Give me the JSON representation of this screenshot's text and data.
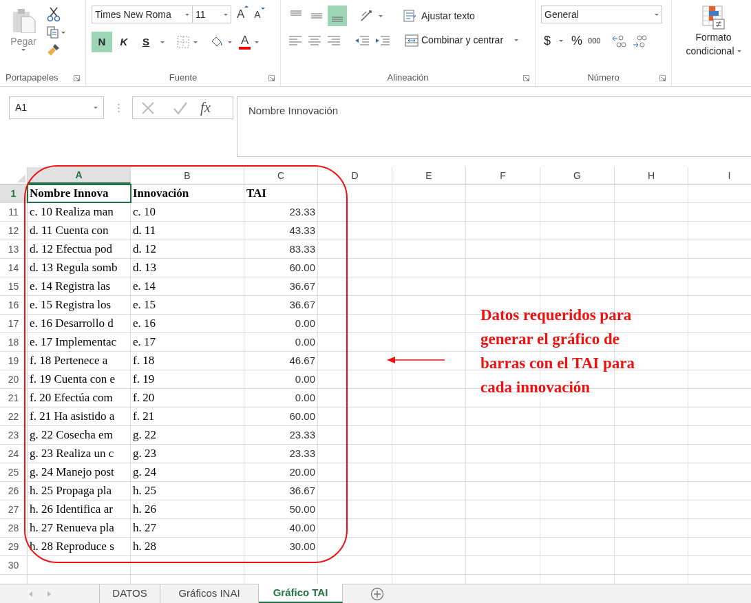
{
  "ribbon": {
    "clipboard": {
      "paste_label": "Pegar",
      "group_label": "Portapapeles"
    },
    "font": {
      "name": "Times New Roma",
      "size": "11",
      "grow_label": "A",
      "shrink_label": "A",
      "color_label": "A",
      "group_label": "Fuente",
      "style_buttons": [
        {
          "label": "N",
          "selected": true
        },
        {
          "label": "K",
          "selected": false
        },
        {
          "label": "S",
          "selected": false
        }
      ]
    },
    "alignment": {
      "group_label": "Alineación",
      "wrap_label": "Ajustar texto",
      "merge_label": "Combinar y centrar",
      "vertical_align": [
        {
          "kind": "top",
          "selected": false
        },
        {
          "kind": "middle",
          "selected": false
        },
        {
          "kind": "bottom",
          "selected": true
        }
      ]
    },
    "number": {
      "format": "General",
      "group_label": "Número",
      "symbols": [
        "$",
        "%",
        "000"
      ]
    },
    "styles": {
      "conditional_format_lines": [
        "Formato",
        "condicional"
      ]
    }
  },
  "formula_bar": {
    "name_box": "A1",
    "fx_label": "fx",
    "content": "Nombre Innovación"
  },
  "sheet": {
    "columns": [
      {
        "label": "A",
        "selected": true
      },
      {
        "label": "B",
        "selected": false
      },
      {
        "label": "C",
        "selected": false
      },
      {
        "label": "D",
        "selected": false
      },
      {
        "label": "E",
        "selected": false
      },
      {
        "label": "F",
        "selected": false
      },
      {
        "label": "G",
        "selected": false
      },
      {
        "label": "H",
        "selected": false
      },
      {
        "label": "I",
        "selected": false
      }
    ],
    "rows": [
      {
        "number": "1",
        "selected": true,
        "kind": "header",
        "cells": [
          "Nombre Innova",
          "Innovación",
          "TAI"
        ]
      },
      {
        "number": "11",
        "selected": false,
        "kind": "data",
        "cells": [
          "c. 10 Realiza man",
          "c. 10",
          "23.33"
        ]
      },
      {
        "number": "12",
        "selected": false,
        "kind": "data",
        "cells": [
          "d. 11 Cuenta con",
          "d. 11",
          "43.33"
        ]
      },
      {
        "number": "13",
        "selected": false,
        "kind": "data",
        "cells": [
          "d. 12 Efectua pod",
          "d. 12",
          "83.33"
        ]
      },
      {
        "number": "14",
        "selected": false,
        "kind": "data",
        "cells": [
          "d. 13 Regula somb",
          "d. 13",
          "60.00"
        ]
      },
      {
        "number": "15",
        "selected": false,
        "kind": "data",
        "cells": [
          "e. 14 Registra las",
          "e. 14",
          "36.67"
        ]
      },
      {
        "number": "16",
        "selected": false,
        "kind": "data",
        "cells": [
          "e. 15 Registra los",
          "e. 15",
          "36.67"
        ]
      },
      {
        "number": "17",
        "selected": false,
        "kind": "data",
        "cells": [
          "e. 16 Desarrollo d",
          "e. 16",
          "0.00"
        ]
      },
      {
        "number": "18",
        "selected": false,
        "kind": "data",
        "cells": [
          "e. 17 Implementac",
          "e. 17",
          "0.00"
        ]
      },
      {
        "number": "19",
        "selected": false,
        "kind": "data",
        "cells": [
          "f. 18 Pertenece a",
          "f. 18",
          "46.67"
        ]
      },
      {
        "number": "20",
        "selected": false,
        "kind": "data",
        "cells": [
          "f. 19 Cuenta con e",
          "f. 19",
          "0.00"
        ]
      },
      {
        "number": "21",
        "selected": false,
        "kind": "data",
        "cells": [
          "f. 20 Efectúa com",
          "f. 20",
          "0.00"
        ]
      },
      {
        "number": "22",
        "selected": false,
        "kind": "data",
        "cells": [
          "f. 21 Ha asistido a",
          "f. 21",
          "60.00"
        ]
      },
      {
        "number": "23",
        "selected": false,
        "kind": "data",
        "cells": [
          "g. 22 Cosecha em",
          "g. 22",
          "23.33"
        ]
      },
      {
        "number": "24",
        "selected": false,
        "kind": "data",
        "cells": [
          "g. 23 Realiza un c",
          "g. 23",
          "23.33"
        ]
      },
      {
        "number": "25",
        "selected": false,
        "kind": "data",
        "cells": [
          "g. 24 Manejo post",
          "g. 24",
          "20.00"
        ]
      },
      {
        "number": "26",
        "selected": false,
        "kind": "data",
        "cells": [
          "h. 25 Propaga pla",
          "h. 25",
          "36.67"
        ]
      },
      {
        "number": "27",
        "selected": false,
        "kind": "data",
        "cells": [
          "h. 26 Identifica ar",
          "h. 26",
          "50.00"
        ]
      },
      {
        "number": "28",
        "selected": false,
        "kind": "data",
        "cells": [
          "h. 27 Renueva pla",
          "h. 27",
          "40.00"
        ]
      },
      {
        "number": "29",
        "selected": false,
        "kind": "data",
        "cells": [
          "h. 28 Reproduce s",
          "h. 28",
          "30.00"
        ]
      },
      {
        "number": "30",
        "selected": false,
        "kind": "empty",
        "cells": []
      }
    ]
  },
  "annotation": {
    "text": "Datos requeridos para\ngenerar el gráfico de\nbarras con el TAI para\ncada innovación"
  },
  "sheet_tabs": [
    {
      "label": "DATOS",
      "selected": false
    },
    {
      "label": "Gráficos INAI",
      "selected": false
    },
    {
      "label": "Gráfico TAI",
      "selected": true
    }
  ]
}
